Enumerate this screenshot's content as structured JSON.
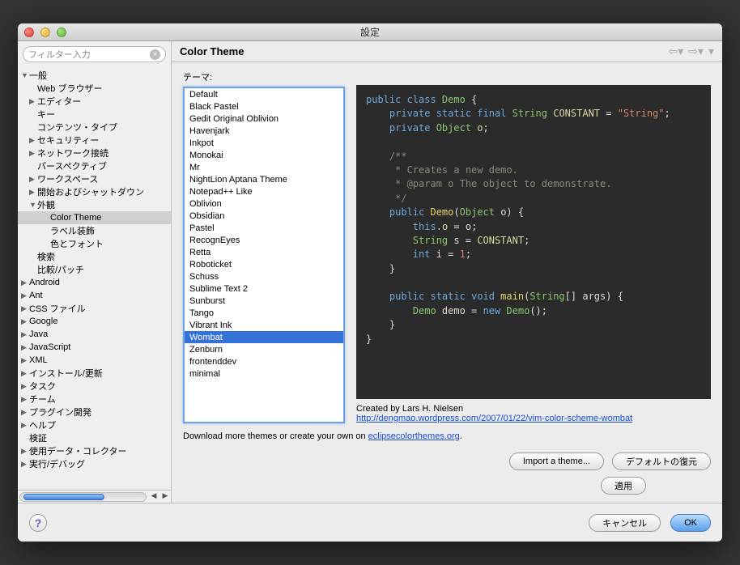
{
  "window_title": "設定",
  "filter_placeholder": "フィルター入力",
  "tree": [
    {
      "label": "一般",
      "depth": 0,
      "arrow": "▼"
    },
    {
      "label": "Web ブラウザー",
      "depth": 1,
      "arrow": ""
    },
    {
      "label": "エディター",
      "depth": 1,
      "arrow": "▶"
    },
    {
      "label": "キー",
      "depth": 1,
      "arrow": ""
    },
    {
      "label": "コンテンツ・タイプ",
      "depth": 1,
      "arrow": ""
    },
    {
      "label": "セキュリティー",
      "depth": 1,
      "arrow": "▶"
    },
    {
      "label": "ネットワーク接続",
      "depth": 1,
      "arrow": "▶"
    },
    {
      "label": "パースペクティブ",
      "depth": 1,
      "arrow": ""
    },
    {
      "label": "ワークスペース",
      "depth": 1,
      "arrow": "▶"
    },
    {
      "label": "開始およびシャットダウン",
      "depth": 1,
      "arrow": "▶"
    },
    {
      "label": "外観",
      "depth": 1,
      "arrow": "▼"
    },
    {
      "label": "Color Theme",
      "depth": 2,
      "arrow": "",
      "selected": true
    },
    {
      "label": "ラベル装飾",
      "depth": 2,
      "arrow": ""
    },
    {
      "label": "色とフォント",
      "depth": 2,
      "arrow": ""
    },
    {
      "label": "検索",
      "depth": 1,
      "arrow": ""
    },
    {
      "label": "比較/パッチ",
      "depth": 1,
      "arrow": ""
    },
    {
      "label": "Android",
      "depth": 0,
      "arrow": "▶"
    },
    {
      "label": "Ant",
      "depth": 0,
      "arrow": "▶"
    },
    {
      "label": "CSS ファイル",
      "depth": 0,
      "arrow": "▶"
    },
    {
      "label": "Google",
      "depth": 0,
      "arrow": "▶"
    },
    {
      "label": "Java",
      "depth": 0,
      "arrow": "▶"
    },
    {
      "label": "JavaScript",
      "depth": 0,
      "arrow": "▶"
    },
    {
      "label": "XML",
      "depth": 0,
      "arrow": "▶"
    },
    {
      "label": "インストール/更新",
      "depth": 0,
      "arrow": "▶"
    },
    {
      "label": "タスク",
      "depth": 0,
      "arrow": "▶"
    },
    {
      "label": "チーム",
      "depth": 0,
      "arrow": "▶"
    },
    {
      "label": "プラグイン開発",
      "depth": 0,
      "arrow": "▶"
    },
    {
      "label": "ヘルプ",
      "depth": 0,
      "arrow": "▶"
    },
    {
      "label": "検証",
      "depth": 0,
      "arrow": ""
    },
    {
      "label": "使用データ・コレクター",
      "depth": 0,
      "arrow": "▶"
    },
    {
      "label": "実行/デバッグ",
      "depth": 0,
      "arrow": "▶"
    }
  ],
  "page_title": "Color Theme",
  "theme_label": "テーマ:",
  "themes": [
    "Default",
    "Black Pastel",
    "Gedit Original Oblivion",
    "Havenjark",
    "Inkpot",
    "Monokai",
    "Mr",
    "NightLion Aptana Theme",
    "Notepad++ Like",
    "Oblivion",
    "Obsidian",
    "Pastel",
    "RecognEyes",
    "Retta",
    "Roboticket",
    "Schuss",
    "Sublime Text 2",
    "Sunburst",
    "Tango",
    "Vibrant Ink",
    "Wombat",
    "Zenburn",
    "frontenddev",
    "minimal"
  ],
  "selected_theme": "Wombat",
  "credits_text": "Created by Lars H. Nielsen",
  "credits_link": "http://dengmao.wordpress.com/2007/01/22/vim-color-scheme-wombat",
  "download_prefix": "Download more themes or create your own on ",
  "download_link_text": "eclipsecolorthemes.org",
  "buttons": {
    "import": "Import a theme...",
    "restore": "デフォルトの復元",
    "apply": "適用",
    "cancel": "キャンセル",
    "ok": "OK"
  },
  "code": {
    "l1a": "public class ",
    "l1b": "Demo",
    "l1c": " {",
    "l2a": "    private static final ",
    "l2b": "String",
    "l2c": " ",
    "l2d": "CONSTANT",
    "l2e": " = ",
    "l2f": "\"String\"",
    "l2g": ";",
    "l3a": "    private ",
    "l3b": "Object",
    "l3c": " ",
    "l3d": "o",
    "l3e": ";",
    "l5": "    /**",
    "l6": "     * Creates a new demo.",
    "l7a": "     * ",
    "l7b": "@param",
    "l7c": " o The object to demonstrate.",
    "l8": "     */",
    "l9a": "    public ",
    "l9b": "Demo",
    "l9c": "(",
    "l9d": "Object",
    "l9e": " o) {",
    "l10a": "        this",
    "l10b": ".",
    "l10c": "o",
    "l10d": " = o;",
    "l11a": "        ",
    "l11b": "String",
    "l11c": " s = ",
    "l11d": "CONSTANT",
    "l11e": ";",
    "l12a": "        int ",
    "l12b": "i",
    "l12c": " = ",
    "l12d": "1",
    "l12e": ";",
    "l13": "    }",
    "l15a": "    public static void ",
    "l15b": "main",
    "l15c": "(",
    "l15d": "String",
    "l15e": "[] args) {",
    "l16a": "        ",
    "l16b": "Demo",
    "l16c": " demo = ",
    "l16d": "new ",
    "l16e": "Demo",
    "l16f": "();",
    "l17": "    }",
    "l18": "}"
  }
}
